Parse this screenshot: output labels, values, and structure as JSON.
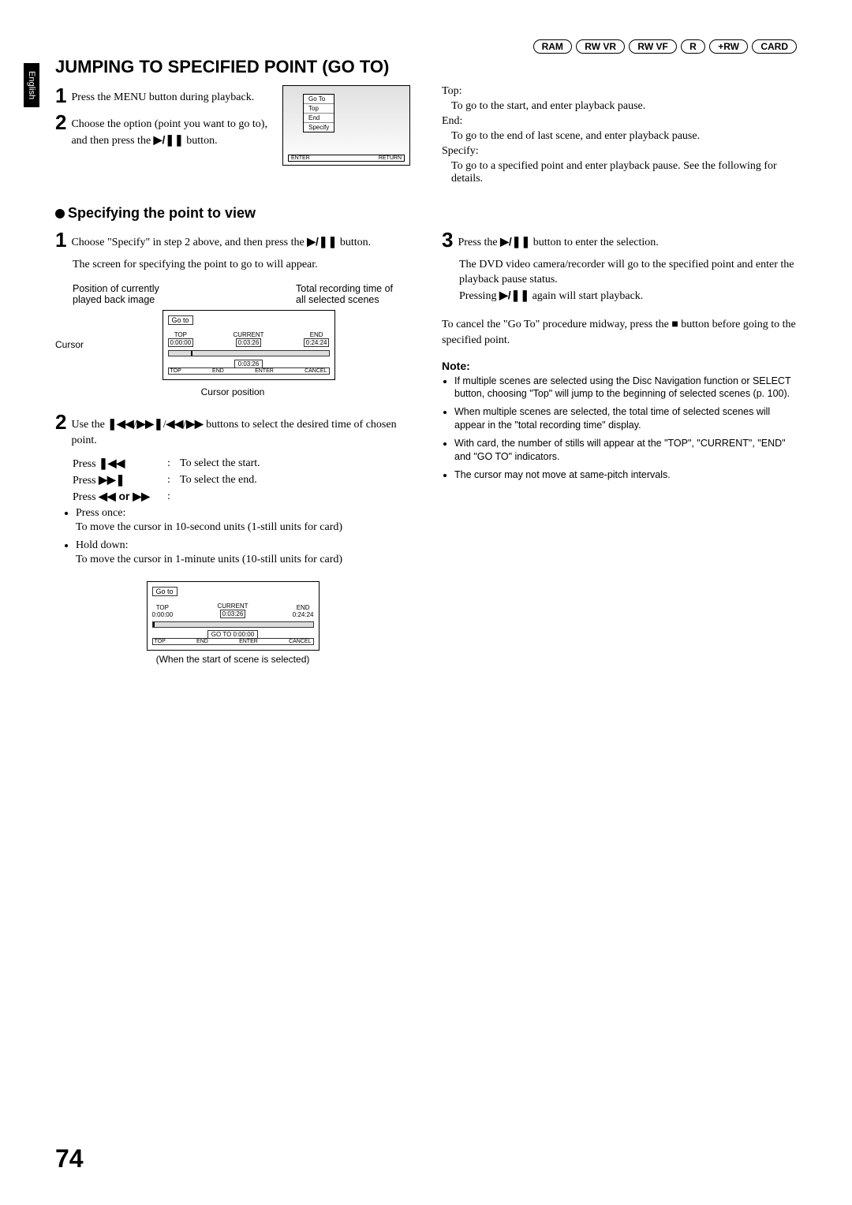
{
  "lang_tab": "English",
  "badges": [
    "RAM",
    "RW VR",
    "RW VF",
    "R",
    "+RW",
    "CARD"
  ],
  "heading": "JUMPING TO SPECIFIED POINT (GO TO)",
  "step1": {
    "num": "1",
    "text": "Press the MENU button during playback."
  },
  "step2": {
    "num": "2",
    "text_a": "Choose the option (point you want to go to), and then press the ",
    "text_b": " button."
  },
  "symbol_playpause": "▶/❚❚",
  "symbol_prev": "❚◀◀",
  "symbol_next": "▶▶❚",
  "symbol_rw": "◀◀",
  "symbol_ff": "▶▶",
  "symbol_stop": "■",
  "menu_diagram": {
    "title": "Go To",
    "items": [
      "Top",
      "End",
      "Specify"
    ],
    "footer_left": "ENTER",
    "footer_right": "RETURN"
  },
  "right_definitions": {
    "top_label": "Top:",
    "top_def": "To go to the start, and enter playback pause.",
    "end_label": "End:",
    "end_def": "To go to the end of last scene, and enter playback pause.",
    "specify_label": "Specify:",
    "specify_def": "To go to a specified point and enter playback pause. See the following for details."
  },
  "subheading": "Specifying the point to view",
  "spec_step1": {
    "num": "1",
    "text_a": "Choose \"Specify\" in step 2 above, and then press the ",
    "text_b": " button.",
    "para2": "The screen for specifying the point to go to will appear."
  },
  "spec_labels": {
    "label1a": "Position of currently",
    "label1b": "played back image",
    "label2a": "Total recording time of",
    "label2b": "all selected scenes",
    "cursor": "Cursor",
    "cursor_pos": "Cursor position"
  },
  "goto_diagram": {
    "title": "Go to",
    "top_label": "TOP",
    "top_val": "0:00:00",
    "cur_label": "CURRENT",
    "cur_val": "0:03:26",
    "end_label": "END",
    "end_val": "0:24:24",
    "goto_row": "0:03:26",
    "footer": [
      "TOP",
      "END",
      "ENTER",
      "CANCEL"
    ]
  },
  "spec_step2": {
    "num": "2",
    "text_a": "Use the ",
    "text_b": " buttons to select the desired time of chosen point."
  },
  "press_rows": {
    "r1_lbl": "Press ",
    "r1_sym": "❚◀◀",
    "r1_val": "To select the start.",
    "r2_lbl": "Press ",
    "r2_sym": "▶▶❚",
    "r2_val": "To select the end.",
    "r3_lbl": "Press ",
    "r3_sym": "◀◀ or ▶▶"
  },
  "press_bullets": {
    "b1_head": "Press once:",
    "b1_body": "To move the cursor in 10-second units (1-still units for card)",
    "b2_head": "Hold down:",
    "b2_body": "To move the cursor in 1-minute units (10-still units for card)"
  },
  "goto_diagram2": {
    "title": "Go to",
    "top_label": "TOP",
    "top_val": "0:00:00",
    "cur_label": "CURRENT",
    "cur_val": "0:03:26",
    "end_label": "END",
    "end_val": "0:24:24",
    "goto_line": "GO TO 0:00:00",
    "footer": [
      "TOP",
      "END",
      "ENTER",
      "CANCEL"
    ]
  },
  "caption2": "(When the start of scene is selected)",
  "spec_step3": {
    "num": "3",
    "text_a": "Press the ",
    "text_b": " button to enter the selection.",
    "para2": "The DVD video camera/recorder will go to the specified point and enter the playback pause status.",
    "para3a": "Pressing ",
    "para3b": " again will start playback."
  },
  "cancel_a": "To cancel the \"Go To\" procedure midway, press the ",
  "cancel_b": " button before going to the specified point.",
  "note_head": "Note:",
  "notes": [
    "If multiple scenes are selected using the Disc Navigation function or SELECT button, choosing \"Top\" will jump to the beginning of selected scenes (p. 100).",
    "When multiple scenes are selected, the total time of selected scenes will appear in the \"total recording time\" display.",
    "With card, the number of stills will appear at the \"TOP\", \"CURRENT\", \"END\" and \"GO TO\" indicators.",
    "The cursor may not move at same-pitch intervals."
  ],
  "page_number": "74"
}
